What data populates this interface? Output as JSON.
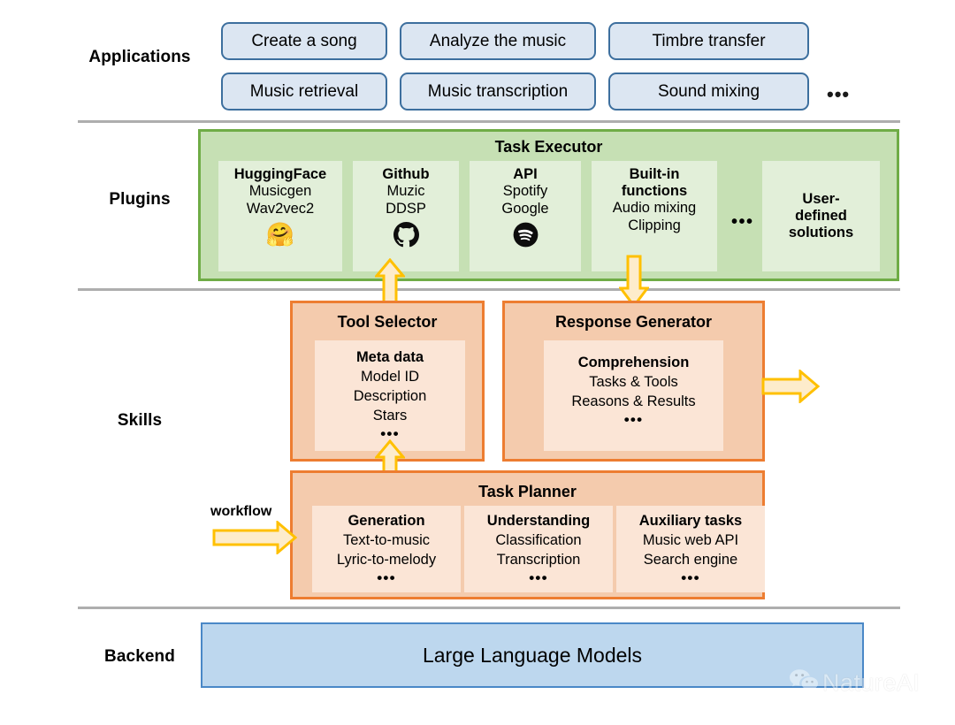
{
  "rows": {
    "applications": {
      "label": "Applications"
    },
    "plugins": {
      "label": "Plugins"
    },
    "skills": {
      "label": "Skills"
    },
    "backend": {
      "label": "Backend"
    }
  },
  "applications": {
    "chips": [
      {
        "label": "Create a song"
      },
      {
        "label": "Analyze the music"
      },
      {
        "label": "Timbre transfer"
      },
      {
        "label": "Music retrieval"
      },
      {
        "label": "Music transcription"
      },
      {
        "label": "Sound mixing"
      }
    ],
    "ellipsis": "•••"
  },
  "plugins": {
    "panel_title": "Task Executor",
    "ellipsis": "•••",
    "cards": [
      {
        "title": "HuggingFace",
        "lines": [
          "Musicgen",
          "Wav2vec2"
        ],
        "icon": "huggingface-icon",
        "icon_glyph": "🤗"
      },
      {
        "title": "Github",
        "lines": [
          "Muzic",
          "DDSP"
        ],
        "icon": "github-icon",
        "icon_glyph": ""
      },
      {
        "title": "API",
        "lines": [
          "Spotify",
          "Google"
        ],
        "icon": "spotify-icon",
        "icon_glyph": ""
      },
      {
        "title": "Built-in\nfunctions",
        "title_line1": "Built-in",
        "title_line2": "functions",
        "lines": [
          "Audio mixing",
          "Clipping"
        ],
        "icon": "none",
        "icon_glyph": ""
      },
      {
        "title_line1": "User-",
        "title_line2": "defined",
        "title_line3": "solutions",
        "lines": [],
        "icon": "none",
        "icon_glyph": ""
      }
    ]
  },
  "skills": {
    "tool_selector": {
      "title": "Tool Selector",
      "card": {
        "title": "Meta data",
        "lines": [
          "Model ID",
          "Description",
          "Stars"
        ],
        "ellipsis": "•••"
      }
    },
    "response_generator": {
      "title": "Response Generator",
      "card": {
        "title": "Comprehension",
        "lines": [
          "Tasks & Tools",
          "Reasons & Results"
        ],
        "ellipsis": "•••"
      }
    },
    "task_planner": {
      "title": "Task Planner",
      "cards": [
        {
          "title": "Generation",
          "lines": [
            "Text-to-music",
            "Lyric-to-melody"
          ],
          "ellipsis": "•••"
        },
        {
          "title": "Understanding",
          "lines": [
            "Classification",
            "Transcription"
          ],
          "ellipsis": "•••"
        },
        {
          "title": "Auxiliary tasks",
          "lines": [
            "Music web API",
            "Search engine"
          ],
          "ellipsis": "•••"
        }
      ]
    },
    "workflow_label": "workflow"
  },
  "backend": {
    "box_label": "Large Language Models"
  },
  "watermark": {
    "text": "NatureAI",
    "icon": "wechat-icon"
  },
  "colors": {
    "app_fill": "#dce6f2",
    "app_border": "#3d6f9e",
    "green_fill": "#c6e0b4",
    "green_border": "#6fac46",
    "green_card": "#e2efd9",
    "orange_fill": "#f4cbad",
    "orange_border": "#ed7d31",
    "orange_card": "#fbe5d6",
    "backend_fill": "#bdd7ee",
    "backend_border": "#4a88c7",
    "arrow_fill": "#fdeccb",
    "arrow_border": "#ffc000",
    "separator": "#aeaeae"
  }
}
